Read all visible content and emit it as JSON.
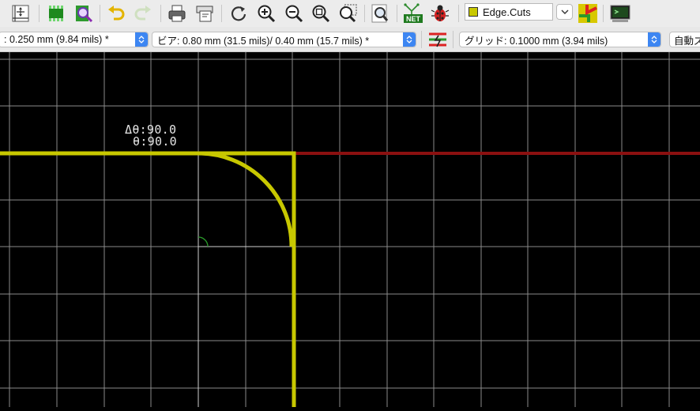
{
  "toolbar": {
    "icons": [
      "pcb-layout-icon",
      "footprint-editor-icon",
      "footprint-viewer-icon",
      "undo-icon",
      "redo-icon",
      "print-icon",
      "plot-icon",
      "redraw-icon",
      "zoom-in-icon",
      "zoom-out-icon",
      "zoom-fit-icon",
      "zoom-selection-icon",
      "find-icon",
      "netlist-icon",
      "drc-bug-icon",
      "layer-pair-icon",
      "scripting-console-icon"
    ],
    "net_label": "NET",
    "layer": {
      "name": "Edge.Cuts",
      "swatch_color": "#c8c800"
    }
  },
  "options": {
    "track_width": ": 0.250 mm (9.84 mils) *",
    "via_size": "ビア: 0.80 mm (31.5 mils)/ 0.40 mm (15.7 mils) *",
    "grid": "グリッド: 0.1000 mm (3.94 mils)",
    "auto_zoom": "自動ズ"
  },
  "canvas": {
    "background": "#000000",
    "grid_color": "#8a8a8a",
    "edge_cuts_color": "#c8c800",
    "highlight_track_color": "#8b1010",
    "arc_marker_color": "#2a9a2a",
    "delta_angle": "Δθ:90.0",
    "angle": "θ:90.0"
  }
}
